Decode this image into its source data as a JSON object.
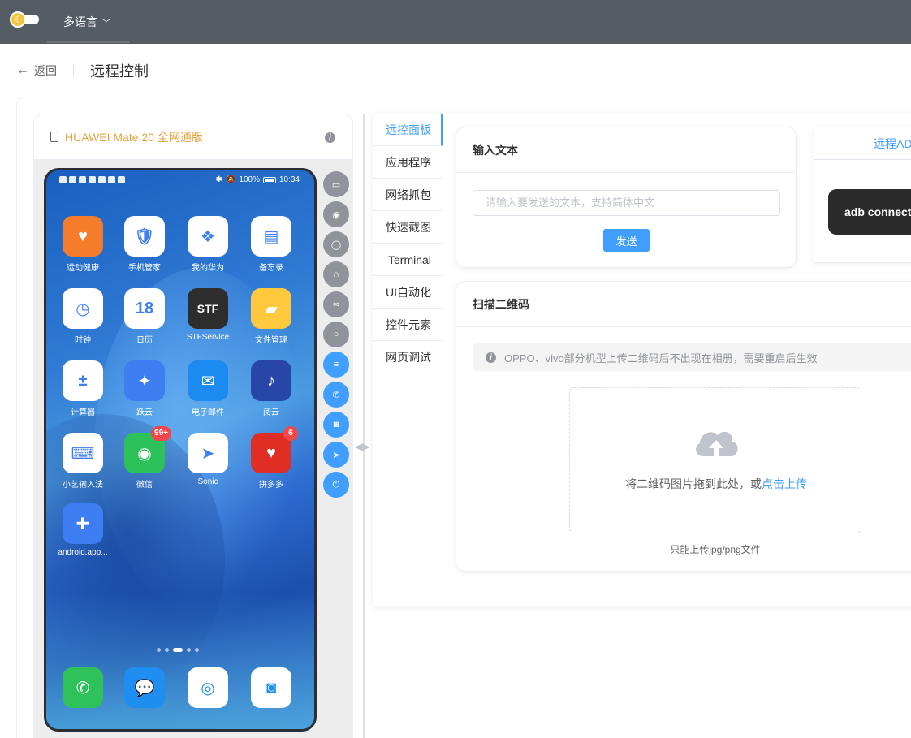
{
  "topbar": {
    "lang_label": "多语言"
  },
  "header": {
    "back_label": "返回",
    "title": "远程控制"
  },
  "device": {
    "name": "HUAWEI Mate 20 全网通版",
    "status": {
      "battery": "100%",
      "time": "10:34"
    },
    "apps": [
      {
        "label": "运动健康",
        "color": "#f47c2a",
        "glyph": "♥"
      },
      {
        "label": "手机管家",
        "color": "#ffffff",
        "glyph": "🛡"
      },
      {
        "label": "我的华为",
        "color": "#ffffff",
        "glyph": "❖"
      },
      {
        "label": "备忘录",
        "color": "#ffffff",
        "glyph": "▤"
      },
      {
        "label": "时钟",
        "color": "#ffffff",
        "glyph": "◷"
      },
      {
        "label": "日历",
        "color": "#ffffff",
        "glyph": "18"
      },
      {
        "label": "STFService",
        "color": "#2d2d2d",
        "glyph": "STF"
      },
      {
        "label": "文件管理",
        "color": "#ffc83d",
        "glyph": "▰"
      },
      {
        "label": "计算器",
        "color": "#ffffff",
        "glyph": "±"
      },
      {
        "label": "跃云",
        "color": "#3d7ef2",
        "glyph": "✦"
      },
      {
        "label": "电子邮件",
        "color": "#1b8bf2",
        "glyph": "✉"
      },
      {
        "label": "阅云",
        "color": "#2846a8",
        "glyph": "♪"
      },
      {
        "label": "小艺输入法",
        "color": "#ffffff",
        "glyph": "⌨"
      },
      {
        "label": "微信",
        "color": "#2dc15a",
        "glyph": "◉",
        "badge": "99+"
      },
      {
        "label": "Sonic",
        "color": "#ffffff",
        "glyph": "➤"
      },
      {
        "label": "拼多多",
        "color": "#e02e24",
        "glyph": "♥",
        "badge": "6"
      },
      {
        "label": "android.app...",
        "color": "#3d7ef2",
        "glyph": "✚"
      }
    ],
    "dock": [
      {
        "color": "#2fc25a",
        "glyph": "✆"
      },
      {
        "color": "#1e8ff0",
        "glyph": "💬"
      },
      {
        "color": "#ffffff",
        "glyph": "◎"
      },
      {
        "color": "#ffffff",
        "glyph": "◙"
      }
    ]
  },
  "tabs": [
    "远控面板",
    "应用程序",
    "网络抓包",
    "快速截图",
    "Terminal",
    "UI自动化",
    "控件元素",
    "网页调试"
  ],
  "input_card": {
    "title": "输入文本",
    "placeholder": "请输入要发送的文本，支持简体中文",
    "send_label": "发送"
  },
  "adb_card": {
    "tab": "远程ADB",
    "command": "adb connect"
  },
  "qr_card": {
    "title": "扫描二维码",
    "alert": "OPPO、vivo部分机型上传二维码后不出现在相册，需要重启后生效",
    "upload_text": "将二维码图片拖到此处，或",
    "upload_link": "点击上传",
    "tip": "只能上传jpg/png文件"
  },
  "colors": {
    "primary": "#409eff",
    "topbar": "#545c64",
    "warning": "#e6a23c"
  }
}
